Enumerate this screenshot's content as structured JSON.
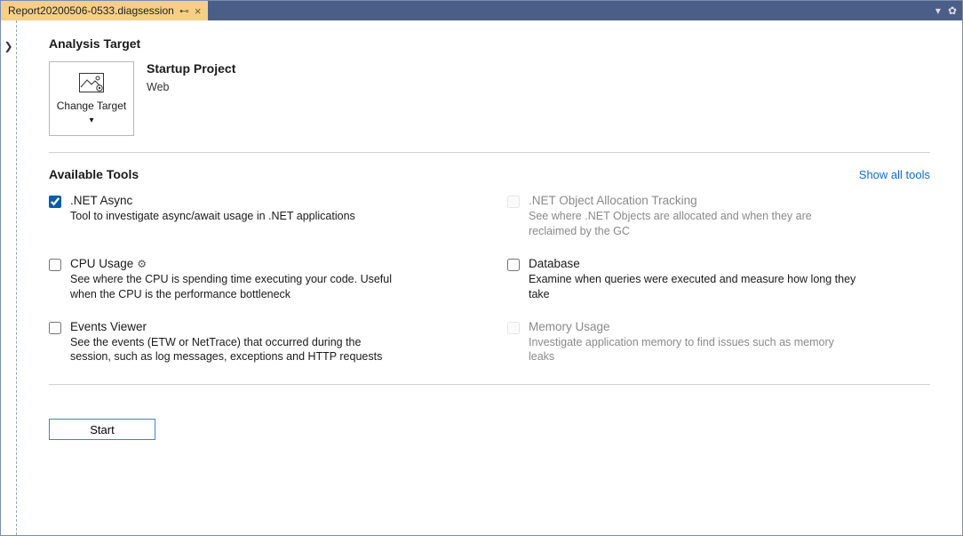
{
  "tab": {
    "title": "Report20200506-0533.diagsession"
  },
  "analysis_target": {
    "heading": "Analysis Target",
    "change_target": "Change Target",
    "project_title": "Startup Project",
    "project_sub": "Web"
  },
  "available_tools": {
    "heading": "Available Tools",
    "show_all": "Show all tools"
  },
  "tools": {
    "net_async": {
      "name": ".NET Async",
      "desc": "Tool to investigate async/await usage in .NET applications"
    },
    "net_alloc": {
      "name": ".NET Object Allocation Tracking",
      "desc": "See where .NET Objects are allocated and when they are reclaimed by the GC"
    },
    "cpu": {
      "name": "CPU Usage",
      "desc": "See where the CPU is spending time executing your code. Useful when the CPU is the performance bottleneck"
    },
    "database": {
      "name": "Database",
      "desc": "Examine when queries were executed and measure how long they take"
    },
    "events": {
      "name": "Events Viewer",
      "desc": "See the events (ETW or NetTrace) that occurred during the session, such as log messages, exceptions and HTTP requests"
    },
    "memory": {
      "name": "Memory Usage",
      "desc": "Investigate application memory to find issues such as memory leaks"
    }
  },
  "start_button": "Start"
}
